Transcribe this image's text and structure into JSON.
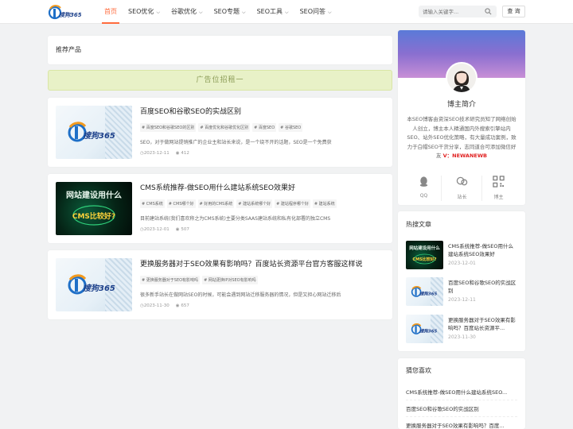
{
  "header": {
    "logo_text": "搜狗365",
    "nav": [
      {
        "label": "首页",
        "has_dropdown": false,
        "active": true
      },
      {
        "label": "SEO优化",
        "has_dropdown": true,
        "active": false
      },
      {
        "label": "谷歌优化",
        "has_dropdown": true,
        "active": false
      },
      {
        "label": "SEO专题",
        "has_dropdown": true,
        "active": false
      },
      {
        "label": "SEO工具",
        "has_dropdown": true,
        "active": false
      },
      {
        "label": "SEO问答",
        "has_dropdown": true,
        "active": false
      }
    ],
    "search_placeholder": "请输入关键字...",
    "search_button": "查 询",
    "accent": "#ff6b3d"
  },
  "main": {
    "section_title": "推荐产品",
    "ad_text": "广告位招租一",
    "posts": [
      {
        "title": "百度SEO和谷歌SEO的实战区别",
        "tags": [
          "# 百度SEO和谷歌SEO的区别",
          "# 百度优化和谷歌优化区别",
          "# 百度SEO",
          "# 谷歌SEO"
        ],
        "excerpt": "SEO，对于做网站提销推广的企业主和站长来说，是一个绕不开的话题，SEO是一个免费获",
        "date": "2023-12-11",
        "views": "412",
        "thumb": "logo"
      },
      {
        "title": "CMS系统推荐-做SEO用什么建站系统SEO效果好",
        "tags": [
          "# CMS系统",
          "# CMS哪个好",
          "# 好用的CMS系统",
          "# 建站系统哪个好",
          "# 建站程序哪个好",
          "# 建站系统"
        ],
        "excerpt": "目前建站系统(我们喜欢称之为CMS系统)主要分类SAAS建站系统和私有化部署的独立CMS",
        "date": "2023-12-01",
        "views": "507",
        "thumb": "cms"
      },
      {
        "title": "更换服务器对于SEO效果有影响吗？百度站长资源平台官方客服这样说",
        "tags": [
          "# 更换服务器对于SEO有影响吗",
          "# 网站更换IP对SEO有影响吗"
        ],
        "excerpt": "很多新手站长在做网站SEO的时候，可能会遇到网站迁移服务器的情况，但是又担心网站迁移后",
        "date": "2023-11-30",
        "views": "657",
        "thumb": "logo"
      }
    ]
  },
  "sidebar": {
    "profile": {
      "name": "博主简介",
      "desc": "本SEO博客由资深SEO技术研究员知了网络创始人创立，博主本人精通国内外搜索引擎站内SEO、站外SEO优化策略，有大量成功案例，致力于白帽SEO干货分享，志同道合可添加微信好友",
      "wechat": "V：NEWANEWB",
      "social": [
        {
          "label": "QQ",
          "icon": "qq-icon"
        },
        {
          "label": "站长",
          "icon": "webmaster-icon"
        },
        {
          "label": "博主",
          "icon": "qrcode-icon"
        }
      ]
    },
    "hot": {
      "title": "热搜文章",
      "items": [
        {
          "title": "CMS系统推荐-做SEO用什么建站系统SEO效果好",
          "date": "2023-12-01",
          "thumb": "cms"
        },
        {
          "title": "百度SEO和谷歌SEO的实战区别",
          "date": "2023-12-11",
          "thumb": "logo"
        },
        {
          "title": "更换服务器对于SEO效果有影响吗？百度站长资源平...",
          "date": "2023-11-30",
          "thumb": "logo"
        }
      ]
    },
    "guess": {
      "title": "猜您喜欢",
      "items": [
        "CMS系统推荐-做SEO用什么建站系统SEO...",
        "百度SEO和谷歌SEO的实战区别",
        "更换服务器对于SEO效果有影响吗？百度..."
      ]
    }
  }
}
